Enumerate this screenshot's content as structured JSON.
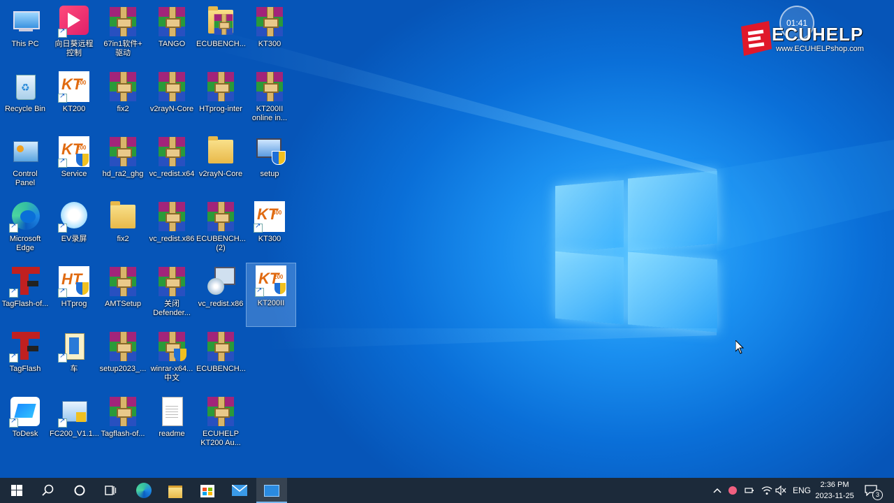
{
  "timer": "01:41",
  "brand": {
    "name": "ECUHELP",
    "url": "www.ECUHELPshop.com"
  },
  "icons": [
    {
      "label": "This PC"
    },
    {
      "label": "向日葵远程\n控制"
    },
    {
      "label": "67in1软件+\n驱动"
    },
    {
      "label": "TANGO"
    },
    {
      "label": "ECUBENCH..."
    },
    {
      "label": "KT300"
    },
    {
      "label": "Recycle Bin"
    },
    {
      "label": "KT200"
    },
    {
      "label": "fix2"
    },
    {
      "label": "v2rayN-Core"
    },
    {
      "label": "HTprog-inter"
    },
    {
      "label": "KT200II\nonline in..."
    },
    {
      "label": "Control\nPanel"
    },
    {
      "label": "Service"
    },
    {
      "label": "hd_ra2_ghg"
    },
    {
      "label": "vc_redist.x64"
    },
    {
      "label": "v2rayN-Core"
    },
    {
      "label": "setup"
    },
    {
      "label": "Microsoft\nEdge"
    },
    {
      "label": "EV录屏"
    },
    {
      "label": "fix2"
    },
    {
      "label": "vc_redist.x86"
    },
    {
      "label": "ECUBENCH...\n(2)"
    },
    {
      "label": "KT300"
    },
    {
      "label": "TagFlash-of..."
    },
    {
      "label": "HTprog"
    },
    {
      "label": "AMTSetup"
    },
    {
      "label": "关闭\nDefender..."
    },
    {
      "label": "vc_redist.x86"
    },
    {
      "label": "KT200II"
    },
    {
      "label": "TagFlash"
    },
    {
      "label": "车"
    },
    {
      "label": "setup2023_..."
    },
    {
      "label": "winrar-x64...\n中文"
    },
    {
      "label": "ECUBENCH..."
    },
    {
      "label": "ToDesk"
    },
    {
      "label": "FC200_V1.1..."
    },
    {
      "label": "Tagflash-of..."
    },
    {
      "label": "readme"
    },
    {
      "label": "ECUHELP\nKT200 Au..."
    }
  ],
  "tray": {
    "lang": "ENG",
    "time": "2:36 PM",
    "date": "2023-11-25",
    "notifications": "3"
  }
}
